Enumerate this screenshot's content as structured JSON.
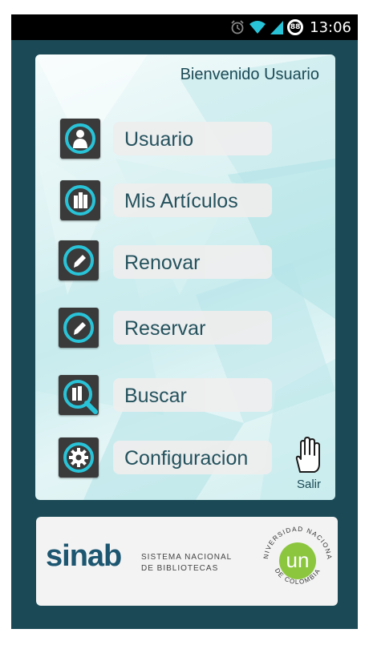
{
  "status_bar": {
    "time": "13:06",
    "battery_level": "88"
  },
  "header": {
    "welcome": "Bienvenido Usuario"
  },
  "menu": [
    {
      "label": "Usuario",
      "icon": "user-icon"
    },
    {
      "label": "Mis Artículos",
      "icon": "books-icon"
    },
    {
      "label": "Renovar",
      "icon": "pencil-icon"
    },
    {
      "label": "Reservar",
      "icon": "pencil-icon"
    },
    {
      "label": "Buscar",
      "icon": "search-icon"
    },
    {
      "label": "Configuracion",
      "icon": "gear-icon"
    }
  ],
  "exit": {
    "label": "Salir",
    "icon": "hand-icon"
  },
  "footer": {
    "sinab": "sinab",
    "sinab_line1": "SISTEMA NACIONAL",
    "sinab_line2": "DE BIBLIOTECAS",
    "university_top": "UNIVERSIDAD NACIONAL",
    "university_bottom": "DE COLOMBIA",
    "university_logo_text": "un"
  },
  "colors": {
    "background": "#1b4a56",
    "accent": "#29c3d8",
    "icon_bg": "#3a3a3a",
    "green": "#8cc63f"
  }
}
